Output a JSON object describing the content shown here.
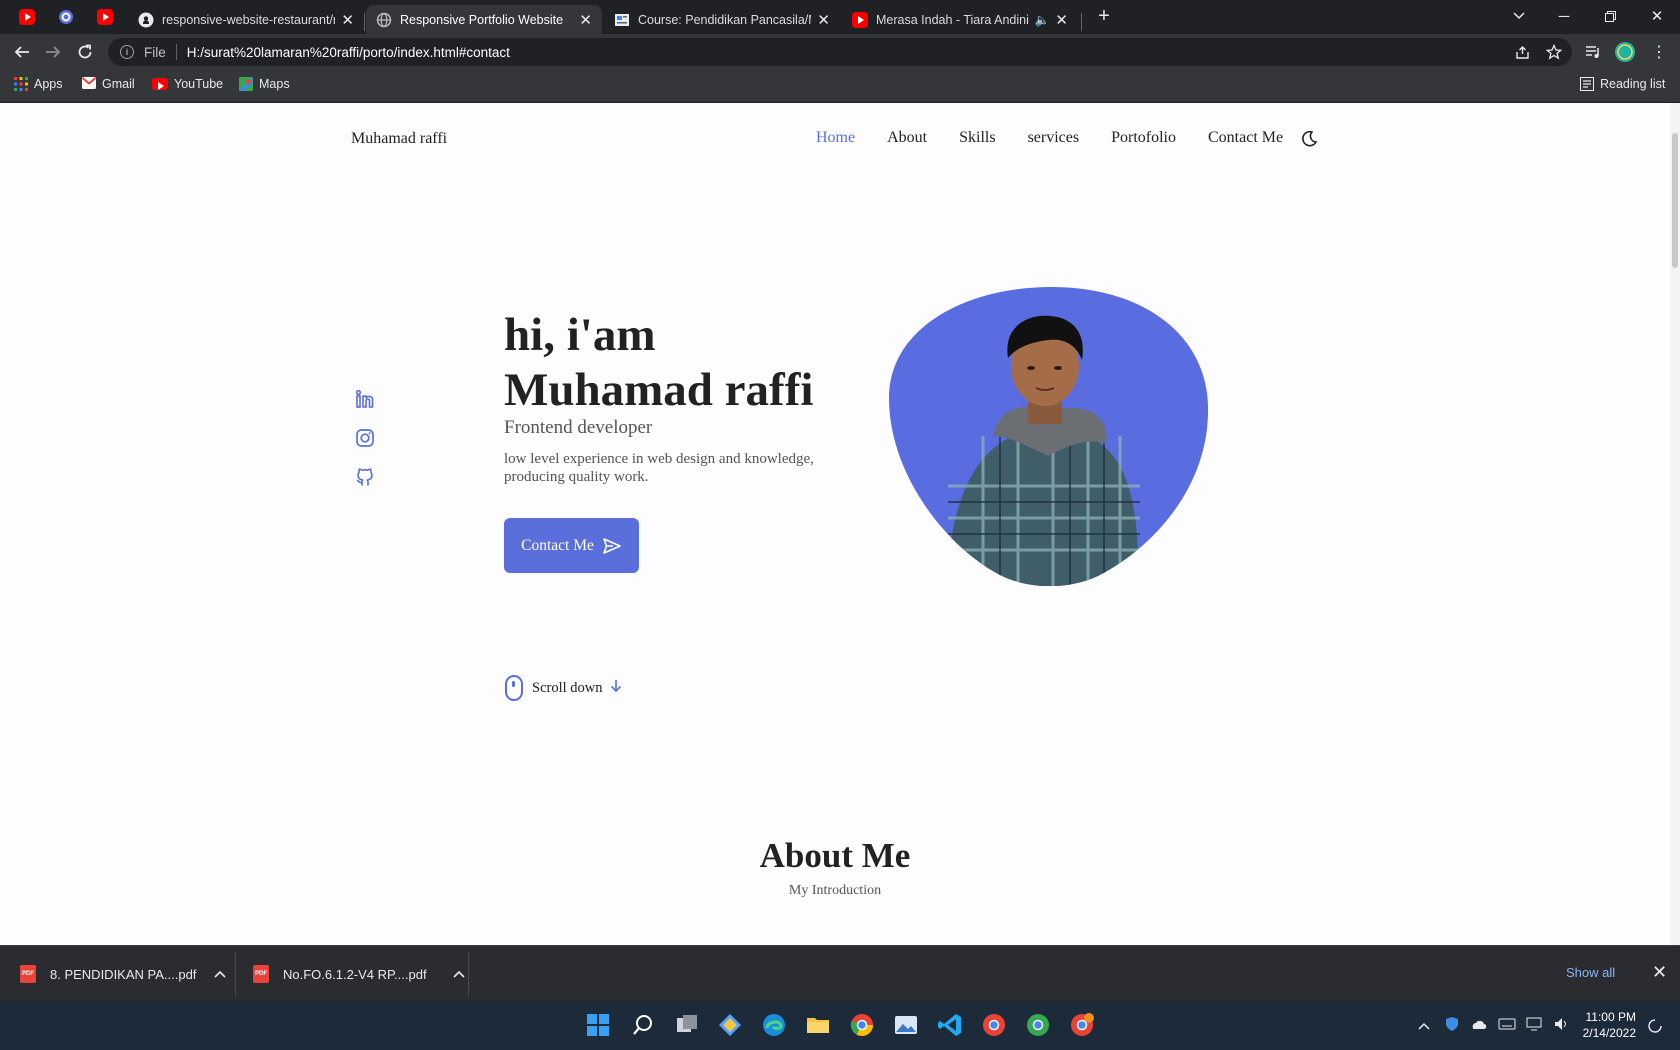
{
  "browser": {
    "tabs": [
      {
        "title": "",
        "favicon": "youtube-icon"
      },
      {
        "title": "",
        "favicon": "app-icon"
      },
      {
        "title": "",
        "favicon": "youtube-icon"
      },
      {
        "title": "responsive-website-restaurant/m",
        "favicon": "github-icon"
      },
      {
        "title": "Responsive Portfolio Website",
        "favicon": "globe-icon",
        "active": true
      },
      {
        "title": "Course: Pendidikan Pancasila/MP",
        "favicon": "course-icon"
      },
      {
        "title": "Merasa Indah - Tiara Andini",
        "favicon": "youtube-icon",
        "audio": true
      }
    ],
    "address": {
      "scheme": "File",
      "url": "H:/surat%20lamaran%20raffi/porto/index.html#contact"
    },
    "bookmarks": [
      {
        "label": "Apps",
        "icon": "apps-grid-icon"
      },
      {
        "label": "Gmail",
        "icon": "gmail-icon"
      },
      {
        "label": "YouTube",
        "icon": "youtube-icon"
      },
      {
        "label": "Maps",
        "icon": "maps-icon"
      }
    ],
    "reading_list": "Reading list"
  },
  "page": {
    "nav": {
      "logo": "Muhamad raffi",
      "links": [
        "Home",
        "About",
        "Skills",
        "services",
        "Portofolio",
        "Contact Me"
      ],
      "active": "Home"
    },
    "hero": {
      "title_line1": "hi, i'am",
      "title_line2": "Muhamad raffi",
      "subtitle": "Frontend developer",
      "description": "low level experience in web design and knowledge, producing quality work.",
      "button": "Contact Me"
    },
    "socials": [
      "linkedin-icon",
      "instagram-icon",
      "github-icon"
    ],
    "scroll_down": "Scroll down",
    "about": {
      "title": "About Me",
      "subtitle": "My Introduction"
    },
    "colors": {
      "accent": "#5b6fdc",
      "blob": "#5a6de0"
    }
  },
  "downloads": {
    "items": [
      {
        "name": "8. PENDIDIKAN PA....pdf"
      },
      {
        "name": "No.FO.6.1.2-V4 RP....pdf"
      }
    ],
    "show_all": "Show all"
  },
  "taskbar": {
    "time": "11:00 PM",
    "date": "2/14/2022"
  }
}
